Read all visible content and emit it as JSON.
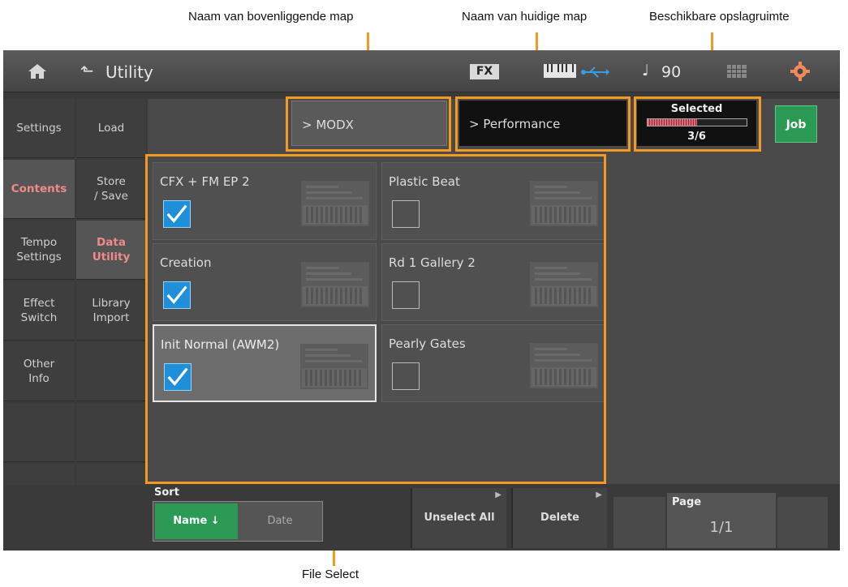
{
  "callouts": {
    "parent_folder": "Naam van bovenliggende map",
    "current_folder": "Naam van huidige map",
    "storage": "Beschikbare opslagruimte",
    "file_select": "File Select"
  },
  "topbar": {
    "title": "Utility",
    "fx_label": "FX",
    "tempo": "90",
    "icons": [
      "home-icon",
      "back-icon",
      "keyboard-icon",
      "usb-icon",
      "note-icon",
      "grid-icon",
      "gear-icon"
    ]
  },
  "tabs_left": [
    {
      "label": "Settings",
      "active": false
    },
    {
      "label": "Contents",
      "active": true
    },
    {
      "label": "Tempo\nSettings",
      "active": false
    },
    {
      "label": "Effect\nSwitch",
      "active": false
    },
    {
      "label": "Other\nInfo",
      "active": false
    }
  ],
  "tabs_sub": [
    {
      "label": "Load",
      "active": false
    },
    {
      "label": "Store\n/ Save",
      "active": false
    },
    {
      "label": "Data\nUtility",
      "active": true
    },
    {
      "label": "Library\nImport",
      "active": false
    }
  ],
  "path": {
    "parent": "> MODX",
    "current": "> Performance"
  },
  "selected": {
    "label": "Selected",
    "value": "3/6",
    "fraction": 0.5
  },
  "job_label": "Job",
  "files": [
    {
      "name": "CFX + FM EP 2",
      "checked": true,
      "highlight": false
    },
    {
      "name": "Plastic Beat",
      "checked": false,
      "highlight": false
    },
    {
      "name": "Creation",
      "checked": true,
      "highlight": false
    },
    {
      "name": "Rd 1 Gallery 2",
      "checked": false,
      "highlight": false
    },
    {
      "name": "Init Normal (AWM2)",
      "checked": true,
      "highlight": true
    },
    {
      "name": "Pearly Gates",
      "checked": false,
      "highlight": false
    }
  ],
  "sort": {
    "label": "Sort",
    "name_btn": "Name ↓",
    "date_btn": "Date"
  },
  "buttons": {
    "unselect_all": "Unselect All",
    "delete": "Delete"
  },
  "page": {
    "label": "Page",
    "value": "1/1"
  },
  "colors": {
    "accent_orange": "#f39a22",
    "job_green": "#2a9a55",
    "check_blue": "#1e8fd8",
    "active_tab_red": "#f08a8a"
  }
}
